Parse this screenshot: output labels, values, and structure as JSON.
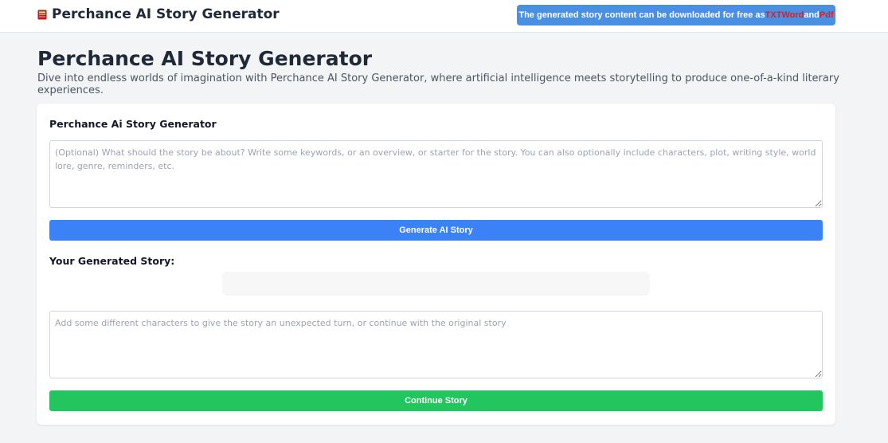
{
  "header": {
    "brand_title": "Perchance AI Story Generator",
    "brand_icon": "book-icon",
    "notice": {
      "text_prefix": "The generated story content can be downloaded for free as ",
      "format_txt": "TXT",
      "format_word": "Word",
      "text_and": " and ",
      "format_pdf": "Pdf"
    }
  },
  "main": {
    "title": "Perchance AI Story Generator",
    "description": "Dive into endless worlds of imagination with Perchance AI Story Generator, where artificial intelligence meets storytelling to produce one-of-a-kind literary experiences."
  },
  "generator": {
    "label": "Perchance Ai Story Generator",
    "prompt_placeholder": "(Optional) What should the story be about? Write some keywords, or an overview, or starter for the story. You can also optionally include characters, plot, writing style, world lore, genre, reminders, etc.",
    "prompt_value": "",
    "generate_label": "Generate AI Story",
    "story_label": "Your Generated Story:",
    "story_text": "",
    "continue_placeholder": "Add some different characters to give the story an unexpected turn, or continue with the original story",
    "continue_value": "",
    "continue_label": "Continue Story"
  },
  "colors": {
    "notice_bg": "#4a90e2",
    "notice_highlight": "#e11d1d",
    "generate_button": "#3b82f6",
    "continue_button": "#22c55e",
    "page_bg": "#f3f4f6"
  }
}
